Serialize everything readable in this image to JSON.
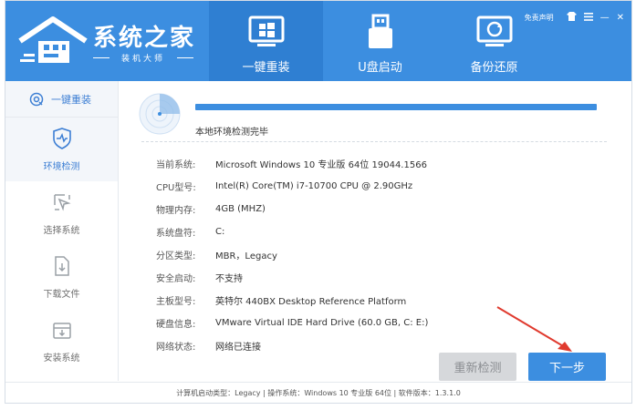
{
  "app": {
    "title": "系统之家",
    "subtitle": "装机大师"
  },
  "window_controls": {
    "disclaimer": "免责声明",
    "shirt_icon": "shirt-icon",
    "menu_icon": "menu-icon",
    "minimize": "—",
    "close": "✕"
  },
  "topnav": [
    {
      "label": "一键重装",
      "icon": "windows-icon",
      "active": true
    },
    {
      "label": "U盘启动",
      "icon": "usb-icon",
      "active": false
    },
    {
      "label": "备份还原",
      "icon": "backup-icon",
      "active": false
    }
  ],
  "sidebar": {
    "top": {
      "label": "一键重装",
      "icon": "reinstall-icon"
    },
    "items": [
      {
        "label": "环境检测",
        "icon": "shield-pulse-icon",
        "active": true
      },
      {
        "label": "选择系统",
        "icon": "cursor-icon",
        "active": false
      },
      {
        "label": "下载文件",
        "icon": "file-download-icon",
        "active": false
      },
      {
        "label": "安装系统",
        "icon": "install-icon",
        "active": false
      }
    ]
  },
  "main": {
    "progress": 1.0,
    "status": "本地环境检测完毕",
    "info": [
      {
        "key": "当前系统:",
        "value": "Microsoft Windows 10 专业版 64位 19044.1566"
      },
      {
        "key": "CPU型号:",
        "value": "Intel(R) Core(TM) i7-10700 CPU @ 2.90GHz"
      },
      {
        "key": "物理内存:",
        "value": "4GB (MHZ)"
      },
      {
        "key": "系统盘符:",
        "value": "C:"
      },
      {
        "key": "分区类型:",
        "value": "MBR，Legacy"
      },
      {
        "key": "安全启动:",
        "value": "不支持"
      },
      {
        "key": "主板型号:",
        "value": "英特尔 440BX Desktop Reference Platform"
      },
      {
        "key": "硬盘信息:",
        "value": "VMware Virtual IDE Hard Drive  (60.0 GB, C: E:)"
      },
      {
        "key": "网络状态:",
        "value": "网络已连接"
      }
    ],
    "redetect_label": "重新检测",
    "next_label": "下一步"
  },
  "footer": {
    "text": "计算机启动类型：Legacy | 操作系统：Windows 10 专业版 64位 | 软件版本：1.3.1.0"
  },
  "colors": {
    "accent": "#3c8ee0",
    "accent_dark": "#2f7fd2",
    "arrow": "#e03a2e"
  }
}
